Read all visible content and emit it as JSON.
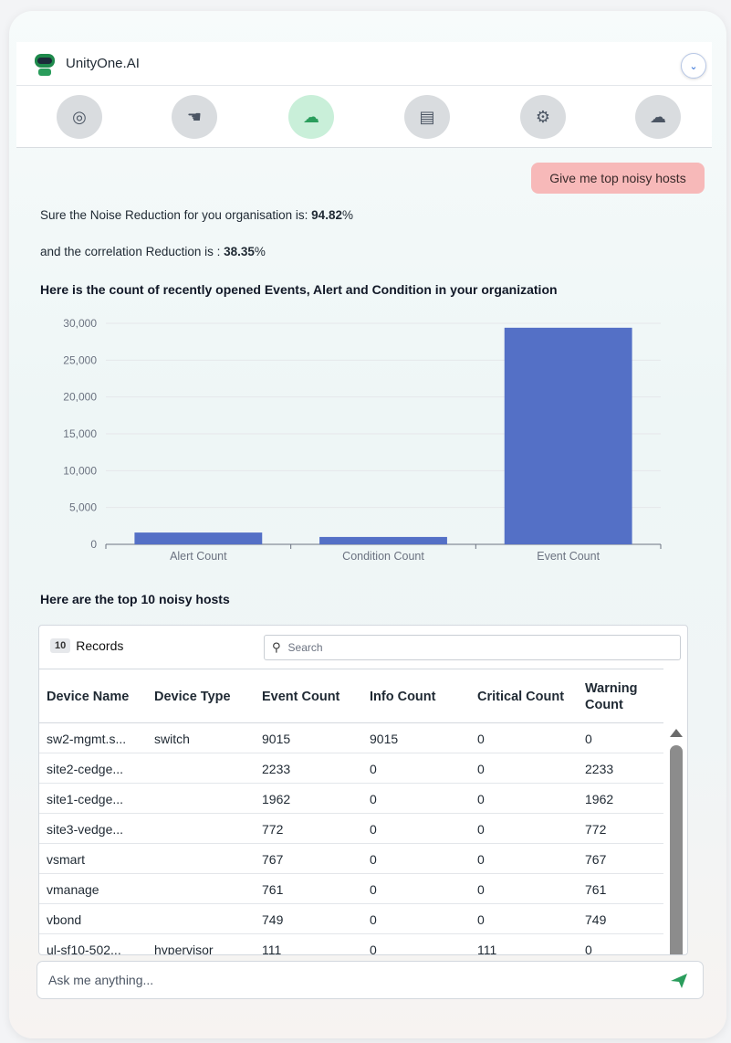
{
  "app": {
    "title": "UnityOne.AI"
  },
  "header": {
    "collapse_icon": "chevron-down-icon",
    "tools": [
      {
        "icon": "lifebuoy-icon",
        "glyph": "◎",
        "active": false
      },
      {
        "icon": "handshake-icon",
        "glyph": "☚",
        "active": false
      },
      {
        "icon": "cloud-sync-icon",
        "glyph": "☁",
        "active": true
      },
      {
        "icon": "billing-icon",
        "glyph": "▤",
        "active": false
      },
      {
        "icon": "gears-icon",
        "glyph": "⚙",
        "active": false
      },
      {
        "icon": "cloud-icon",
        "glyph": "☁",
        "active": false
      }
    ]
  },
  "chat": {
    "user_message": "Give me top noisy hosts",
    "noise_prefix": "Sure the Noise Reduction for you organisation is: ",
    "noise_value": "94.82",
    "noise_suffix": "%",
    "correlation_prefix": "and the correlation Reduction is : ",
    "correlation_value": "38.35",
    "correlation_suffix": "%",
    "chart_heading": "Here is the count of recently opened Events, Alert and Condition in your organization",
    "table_heading": "Here are the top 10 noisy hosts"
  },
  "chart_data": {
    "type": "bar",
    "categories": [
      "Alert Count",
      "Condition Count",
      "Event Count"
    ],
    "values": [
      1600,
      1000,
      29400
    ],
    "ylim": [
      0,
      30000
    ],
    "yticks": [
      "0",
      "5,000",
      "10,000",
      "15,000",
      "20,000",
      "25,000",
      "30,000"
    ],
    "grid": true,
    "color": "#5470c6"
  },
  "table": {
    "records_count": "10",
    "records_label": "Records",
    "search_placeholder": "Search",
    "columns": [
      "Device Name",
      "Device Type",
      "Event Count",
      "Info Count",
      "Critical Count",
      "Warning Count"
    ],
    "rows": [
      [
        "sw2-mgmt.s...",
        "switch",
        "9015",
        "9015",
        "0",
        "0"
      ],
      [
        "site2-cedge...",
        "",
        "2233",
        "0",
        "0",
        "2233"
      ],
      [
        "site1-cedge...",
        "",
        "1962",
        "0",
        "0",
        "1962"
      ],
      [
        "site3-vedge...",
        "",
        "772",
        "0",
        "0",
        "772"
      ],
      [
        "vsmart",
        "",
        "767",
        "0",
        "0",
        "767"
      ],
      [
        "vmanage",
        "",
        "761",
        "0",
        "0",
        "761"
      ],
      [
        "vbond",
        "",
        "749",
        "0",
        "0",
        "749"
      ],
      [
        "ul-sf10-502...",
        "hypervisor",
        "111",
        "0",
        "111",
        "0"
      ]
    ]
  },
  "composer": {
    "placeholder": "Ask me anything...",
    "send_icon": "send-icon",
    "send_color": "#2a9d5c"
  }
}
